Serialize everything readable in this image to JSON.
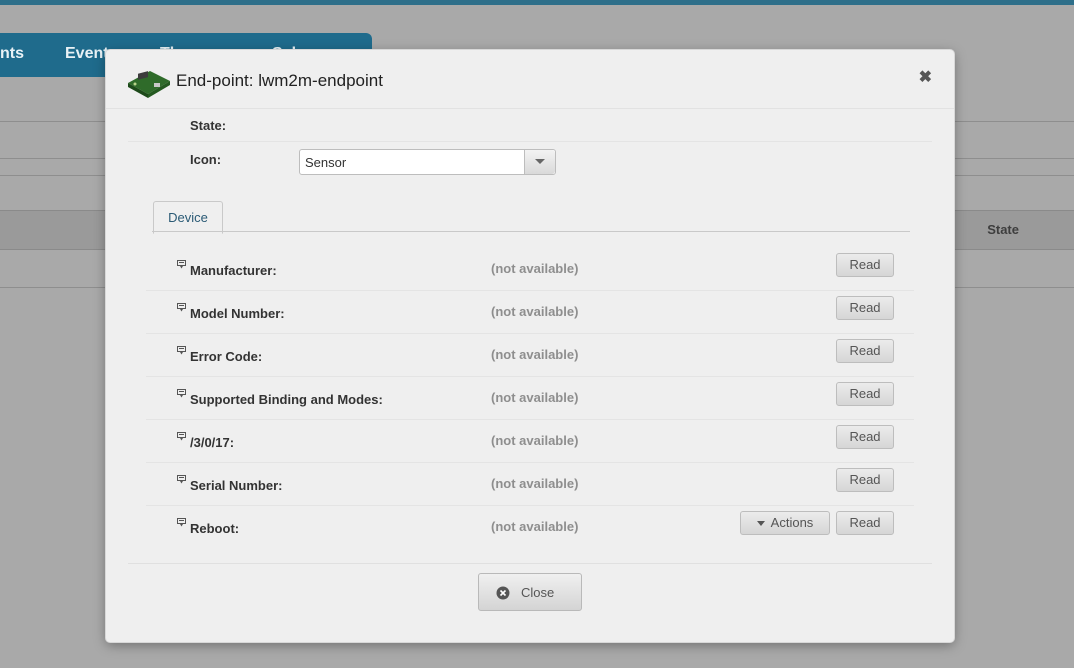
{
  "background": {
    "tabs": [
      "nts",
      "Event",
      "Th",
      "Sch"
    ],
    "column_state": "State"
  },
  "modal": {
    "title": "End-point: lwm2m-endpoint",
    "close_symbol": "✖",
    "state_label": "State:",
    "icon_label": "Icon:",
    "icon_select_value": "Sensor",
    "tab_device": "Device",
    "not_available": "(not available)",
    "read_label": "Read",
    "actions_label": "Actions",
    "close_button": "Close",
    "resources": [
      {
        "label": "Manufacturer:",
        "value": "(not available)",
        "read": "Read"
      },
      {
        "label": "Model Number:",
        "value": "(not available)",
        "read": "Read"
      },
      {
        "label": "Error Code:",
        "value": "(not available)",
        "read": "Read"
      },
      {
        "label": "Supported Binding and Modes:",
        "value": "(not available)",
        "read": "Read"
      },
      {
        "label": "/3/0/17:",
        "value": "(not available)",
        "read": "Read"
      },
      {
        "label": "Serial Number:",
        "value": "(not available)",
        "read": "Read"
      },
      {
        "label": "Reboot:",
        "value": "(not available)",
        "read": "Read",
        "actions": "Actions"
      }
    ]
  },
  "colors": {
    "accent": "#1f6b8c",
    "modal_bg": "#efefef",
    "value_gray": "#8e8e8e"
  }
}
